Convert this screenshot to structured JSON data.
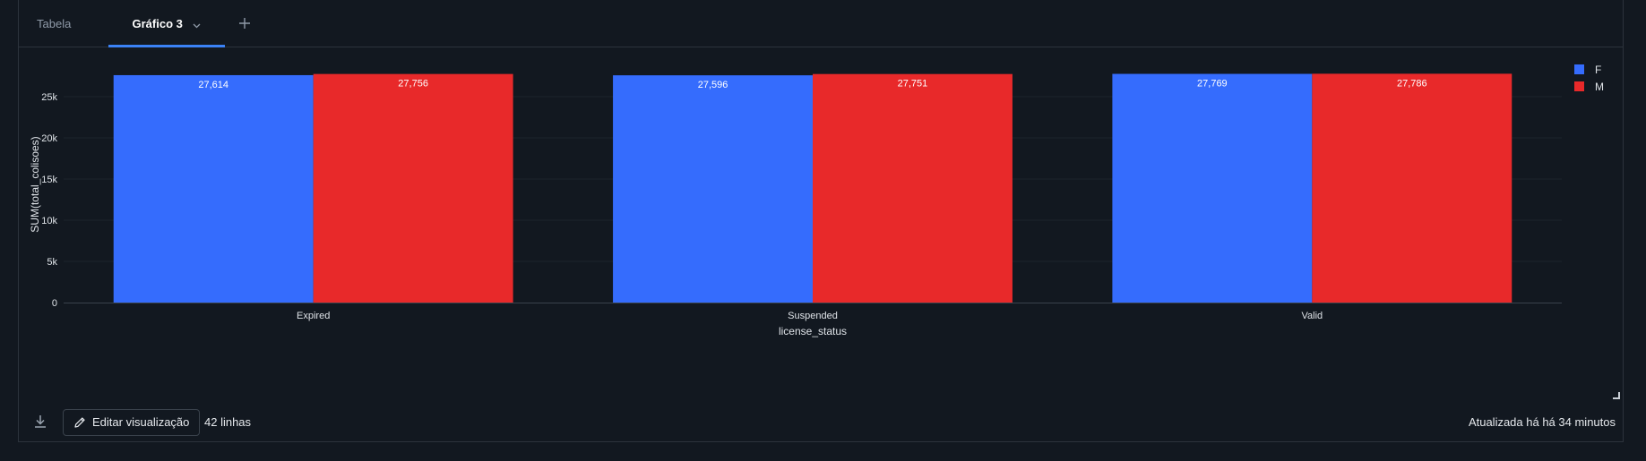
{
  "tabs": [
    {
      "label": "Tabela",
      "active": false
    },
    {
      "label": "Gráfico 3",
      "active": true
    }
  ],
  "footer": {
    "edit_label": "Editar visualização",
    "row_count": "42 linhas",
    "updated": "Atualizada há há 34 minutos"
  },
  "icons": {
    "tab_dropdown": "chevron-down-icon",
    "add_tab": "plus-icon",
    "download": "download-icon",
    "edit": "pencil-icon",
    "resize": "resize-handle-icon"
  },
  "colors": {
    "accent": "#3b82f6",
    "series_f": "#356cfd",
    "series_m": "#e8292a"
  },
  "chart_data": {
    "type": "bar",
    "title": "",
    "xlabel": "license_status",
    "ylabel": "SUM(total_colisoes)",
    "categories": [
      "Expired",
      "Suspended",
      "Valid"
    ],
    "series": [
      {
        "name": "F",
        "color": "#356cfd",
        "values": [
          27614,
          27596,
          27769
        ],
        "labels": [
          "27,614",
          "27,596",
          "27,769"
        ]
      },
      {
        "name": "M",
        "color": "#e8292a",
        "values": [
          27756,
          27751,
          27786
        ],
        "labels": [
          "27,756",
          "27,751",
          "27,786"
        ]
      }
    ],
    "ylim": [
      0,
      30000
    ],
    "yticks": [
      0,
      5000,
      10000,
      15000,
      20000,
      25000
    ],
    "ytick_labels": [
      "0",
      "5k",
      "10k",
      "15k",
      "20k",
      "25k"
    ],
    "grid": true,
    "legend": "top-right"
  }
}
